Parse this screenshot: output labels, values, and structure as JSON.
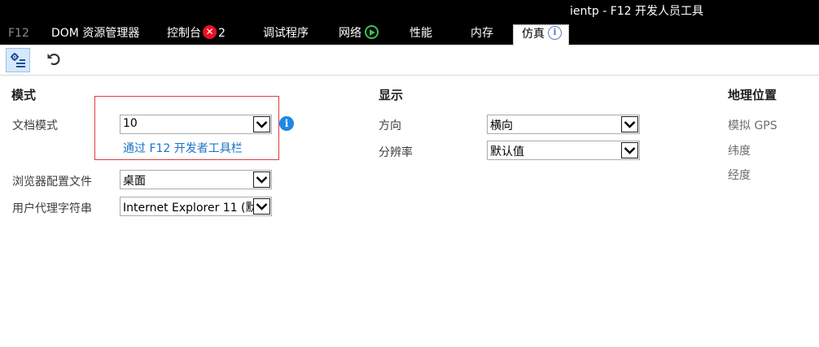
{
  "window": {
    "title": "ientp - F12 开发人员工具"
  },
  "tabs": {
    "brand": "F12",
    "dom": "DOM 资源管理器",
    "console": "控制台",
    "console_error_count": "2",
    "debugger": "调试程序",
    "network": "网络",
    "performance": "性能",
    "memory": "内存",
    "emulation": "仿真"
  },
  "icons": {
    "error": "✕",
    "info": "i"
  },
  "sections": {
    "mode": {
      "title": "模式",
      "document_mode_label": "文档模式",
      "document_mode_value": "10",
      "document_mode_link": "通过 F12 开发者工具栏",
      "browser_profile_label": "浏览器配置文件",
      "browser_profile_value": "桌面",
      "user_agent_label": "用户代理字符串",
      "user_agent_value": "Internet Explorer 11 (默"
    },
    "display": {
      "title": "显示",
      "orientation_label": "方向",
      "orientation_value": "横向",
      "resolution_label": "分辨率",
      "resolution_value": "默认值"
    },
    "geolocation": {
      "title": "地理位置",
      "simulate_gps_label": "模拟 GPS",
      "latitude_label": "纬度",
      "longitude_label": "经度"
    }
  },
  "colors": {
    "chrome_background": "#000000",
    "link": "#1a73c8",
    "highlight_border": "#e03c3c",
    "error_badge": "#e81123",
    "network_play": "#3dbd54",
    "info_badge": "#1e88e5"
  }
}
